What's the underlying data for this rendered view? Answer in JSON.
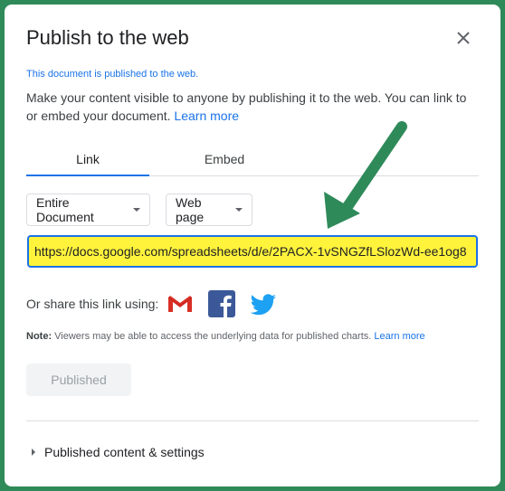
{
  "dialog": {
    "title": "Publish to the web",
    "status": "This document is published to the web.",
    "description": "Make your content visible to anyone by publishing it to the web. You can link to or embed your document.",
    "learn_more": "Learn more"
  },
  "tabs": [
    {
      "label": "Link",
      "active": true
    },
    {
      "label": "Embed",
      "active": false
    }
  ],
  "selects": {
    "document": "Entire Document",
    "format": "Web page"
  },
  "url": {
    "value": "https://docs.google.com/spreadsheets/d/e/2PACX-1vSNGZfLSlozWd-ee1og8"
  },
  "share": {
    "label": "Or share this link using:",
    "icons": [
      "gmail-icon",
      "facebook-icon",
      "twitter-icon"
    ]
  },
  "note": {
    "prefix": "Note:",
    "text": " Viewers may be able to access the underlying data for published charts.",
    "learn_more": "Learn more"
  },
  "buttons": {
    "published": "Published"
  },
  "settings": {
    "label": "Published content & settings"
  },
  "colors": {
    "accent": "#1a73e8",
    "highlight": "#fff33b",
    "annotation_arrow": "#2f8a5a",
    "frame": "#2f8a5a"
  }
}
